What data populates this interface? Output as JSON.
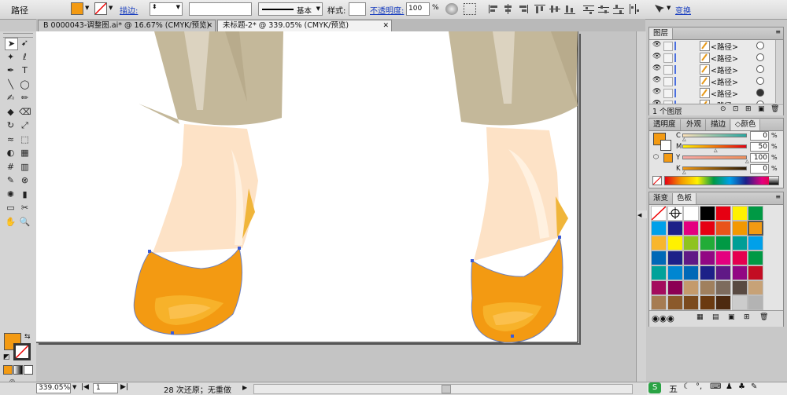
{
  "control_bar": {
    "selection_label": "路径",
    "fill_color": "#f39a12",
    "stroke_label": "描边:",
    "stroke_weight": "",
    "stroke_style_value": "",
    "profile_label": "基本",
    "style_label": "样式:",
    "opacity_label": "不透明度:",
    "opacity_value": "100",
    "opacity_unit": "%",
    "transform_label": "变换"
  },
  "tabs": [
    {
      "label": "B 0000043-调整图.ai* @ 16.67% (CMYK/预览)",
      "close": "✕"
    },
    {
      "label": "未标题-2* @ 339.05% (CMYK/预览)",
      "close": "✕"
    }
  ],
  "tools": {
    "fill_color": "#f39a12",
    "icons": [
      "selection-tool-icon",
      "direct-selection-tool-icon",
      "magic-wand-tool-icon",
      "lasso-tool-icon",
      "pen-tool-icon",
      "type-tool-icon",
      "line-tool-icon",
      "ellipse-tool-icon",
      "paintbrush-tool-icon",
      "pencil-tool-icon",
      "blob-brush-tool-icon",
      "eraser-tool-icon",
      "rotate-tool-icon",
      "scale-tool-icon",
      "width-tool-icon",
      "free-transform-tool-icon",
      "shape-builder-tool-icon",
      "perspective-grid-tool-icon",
      "mesh-tool-icon",
      "gradient-tool-icon",
      "eyedropper-tool-icon",
      "blend-tool-icon",
      "symbol-sprayer-tool-icon",
      "column-graph-tool-icon",
      "artboard-tool-icon",
      "slice-tool-icon",
      "hand-tool-icon",
      "zoom-tool-icon"
    ]
  },
  "layers_panel": {
    "title": "图层",
    "items": [
      "<路径>",
      "<路径>",
      "<路径>",
      "<路径>",
      "<路径>",
      "<路径>"
    ],
    "footer": "1 个图层"
  },
  "color_panel": {
    "tabs": [
      "透明度",
      "外观",
      "描边",
      "颜色"
    ],
    "active_tab": "颜色",
    "channels": [
      {
        "name": "C",
        "value": "0",
        "unit": "%"
      },
      {
        "name": "M",
        "value": "50",
        "unit": "%"
      },
      {
        "name": "Y",
        "value": "100",
        "unit": "%"
      },
      {
        "name": "K",
        "value": "0",
        "unit": "%"
      }
    ],
    "fill": "#f39a12"
  },
  "swatches_panel": {
    "tabs": [
      "渐变",
      "色板"
    ],
    "active_tab": "色板",
    "swatches": [
      "none",
      "registration",
      "#ffffff",
      "#000000",
      "#e60012",
      "#fff100",
      "#009944",
      "#00a0e9",
      "#1d2088",
      "#e4007f",
      "#e60012",
      "#e9541a",
      "#f39800",
      "#f39a12",
      "#f8b62d",
      "#fff100",
      "#8fc31f",
      "#22ac38",
      "#009944",
      "#009e96",
      "#00a0e9",
      "#0068b7",
      "#1d2088",
      "#601986",
      "#920783",
      "#e4007f",
      "#e5004f",
      "#009944",
      "#00a29a",
      "#0086d1",
      "#0068b7",
      "#1d2088",
      "#601986",
      "#920783",
      "#c30d23",
      "#a40b5d",
      "#8c0054",
      "#c49a6c",
      "#a0805e",
      "#7d6b5d",
      "#594a42",
      "#c7a277",
      "#a67c52",
      "#8b5a2b",
      "#7b4a1e",
      "#6b3a10",
      "#4d2a10",
      "#cccccc",
      "#b3b3b3",
      "#999999",
      "#808080",
      "#666666",
      "#4d4d4d",
      "#333333"
    ]
  },
  "status_bar": {
    "zoom": "339.05%",
    "page": "1",
    "message": "28 次还原；无重做"
  },
  "taskbar": {
    "ime_label": "五"
  }
}
